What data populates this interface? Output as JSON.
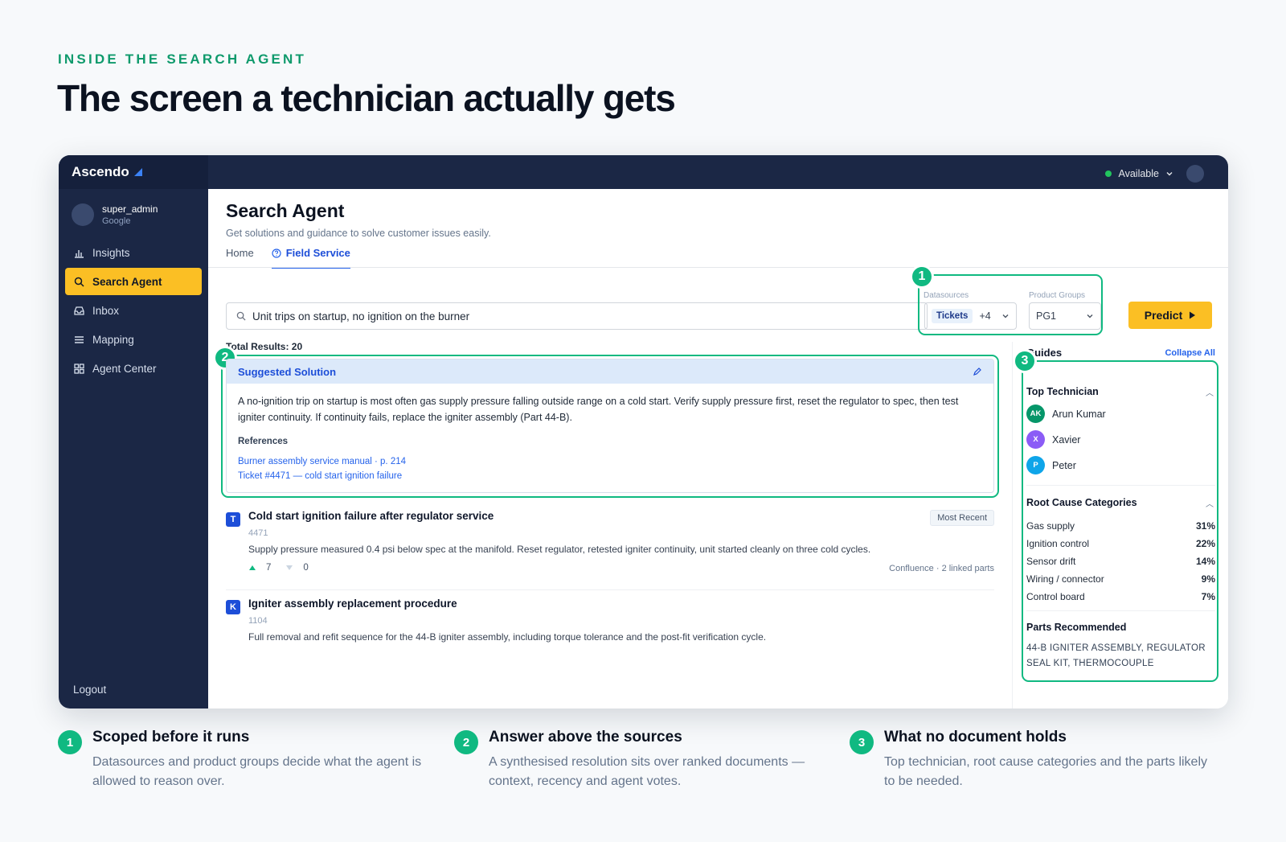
{
  "header": {
    "eyebrow": "INSIDE THE SEARCH AGENT",
    "headline": "The screen a technician actually gets"
  },
  "app": {
    "brand": "Ascendo",
    "user": {
      "name": "super_admin",
      "org": "Google"
    },
    "nav": [
      {
        "label": "Insights",
        "icon": "bar-chart-icon"
      },
      {
        "label": "Search Agent",
        "icon": "search-icon",
        "active": true
      },
      {
        "label": "Inbox",
        "icon": "inbox-icon"
      },
      {
        "label": "Mapping",
        "icon": "list-icon"
      },
      {
        "label": "Agent Center",
        "icon": "grid-icon"
      }
    ],
    "logout": "Logout",
    "status": "Available"
  },
  "page": {
    "title": "Search Agent",
    "subtitle": "Get solutions and guidance to solve customer issues easily.",
    "tabs": [
      {
        "label": "Home"
      },
      {
        "label": "Field Service",
        "active": true
      }
    ]
  },
  "search": {
    "query": "Unit trips on startup, no ignition on the burner"
  },
  "filters": {
    "datasources_label": "Datasources",
    "datasources_chip": "Tickets",
    "datasources_more": "+4",
    "product_groups_label": "Product Groups",
    "product_group": "PG1",
    "predict": "Predict"
  },
  "results": {
    "total": "Total Results: 20",
    "suggested": {
      "title": "Suggested Solution",
      "body": "A no-ignition trip on startup is most often gas supply pressure falling outside range on a cold start. Verify supply pressure first, reset the regulator to spec, then test igniter continuity. If continuity fails, replace the igniter assembly (Part 44-B).",
      "refs_title": "References",
      "refs": [
        "Burner assembly service manual · p. 214",
        "Ticket #4471 — cold start ignition failure"
      ]
    },
    "items": [
      {
        "type": "T",
        "title": "Cold start ignition failure after regulator service",
        "id": "4471",
        "text": "Supply pressure measured 0.4 psi below spec at the manifold. Reset regulator, retested igniter continuity, unit started cleanly on three cold cycles.",
        "tag": "Most Recent",
        "up": "7",
        "down": "0",
        "source": "Confluence · 2 linked parts"
      },
      {
        "type": "K",
        "title": "Igniter assembly replacement procedure",
        "id": "1104",
        "text": "Full removal and refit sequence for the 44-B igniter assembly, including torque tolerance and the post-fit verification cycle."
      }
    ]
  },
  "guides": {
    "title": "Guides",
    "collapse": "Collapse All",
    "top_tech_title": "Top Technician",
    "techs": [
      {
        "initials": "AK",
        "name": "Arun Kumar",
        "color": "#059669"
      },
      {
        "initials": "X",
        "name": "Xavier",
        "color": "#8b5cf6"
      },
      {
        "initials": "P",
        "name": "Peter",
        "color": "#0ea5e9"
      }
    ],
    "root_cause_title": "Root Cause Categories",
    "root_causes": [
      {
        "name": "Gas supply",
        "pct": "31%"
      },
      {
        "name": "Ignition control",
        "pct": "22%"
      },
      {
        "name": "Sensor drift",
        "pct": "14%"
      },
      {
        "name": "Wiring / connector",
        "pct": "9%"
      },
      {
        "name": "Control board",
        "pct": "7%"
      }
    ],
    "parts_title": "Parts Recommended",
    "parts": "44-B IGNITER ASSEMBLY, REGULATOR SEAL KIT, THERMOCOUPLE"
  },
  "callouts": [
    "1",
    "2",
    "3"
  ],
  "captions": [
    {
      "num": "1",
      "title": "Scoped before it runs",
      "body": "Datasources and product groups decide what the agent is allowed to reason over."
    },
    {
      "num": "2",
      "title": "Answer above the sources",
      "body": "A synthesised resolution sits over ranked documents — context, recency and agent votes."
    },
    {
      "num": "3",
      "title": "What no document holds",
      "body": "Top technician, root cause categories and the parts likely to be needed."
    }
  ]
}
